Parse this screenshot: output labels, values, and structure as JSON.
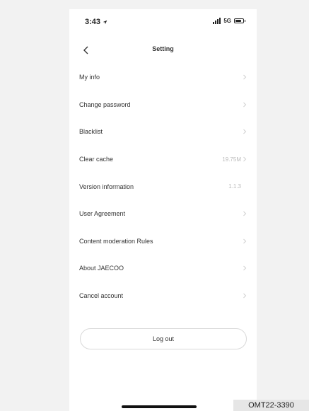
{
  "status_bar": {
    "time": "3:43",
    "network": "5G"
  },
  "nav": {
    "title": "Setting"
  },
  "settings": {
    "items": [
      {
        "label": "My info",
        "value": ""
      },
      {
        "label": "Change password",
        "value": ""
      },
      {
        "label": "Blacklist",
        "value": ""
      },
      {
        "label": "Clear cache",
        "value": "19.75M"
      },
      {
        "label": "Version information",
        "value": "1.1.3"
      },
      {
        "label": "User Agreement",
        "value": ""
      },
      {
        "label": "Content moderation Rules",
        "value": ""
      },
      {
        "label": "About JAECOO",
        "value": ""
      },
      {
        "label": "Cancel account",
        "value": ""
      }
    ]
  },
  "logout_label": "Log out",
  "doc_code": "OMT22-3390",
  "colors": {
    "background": "#f2f2f2",
    "screen": "#ffffff",
    "text": "#333333",
    "muted": "#bbbbbb"
  }
}
